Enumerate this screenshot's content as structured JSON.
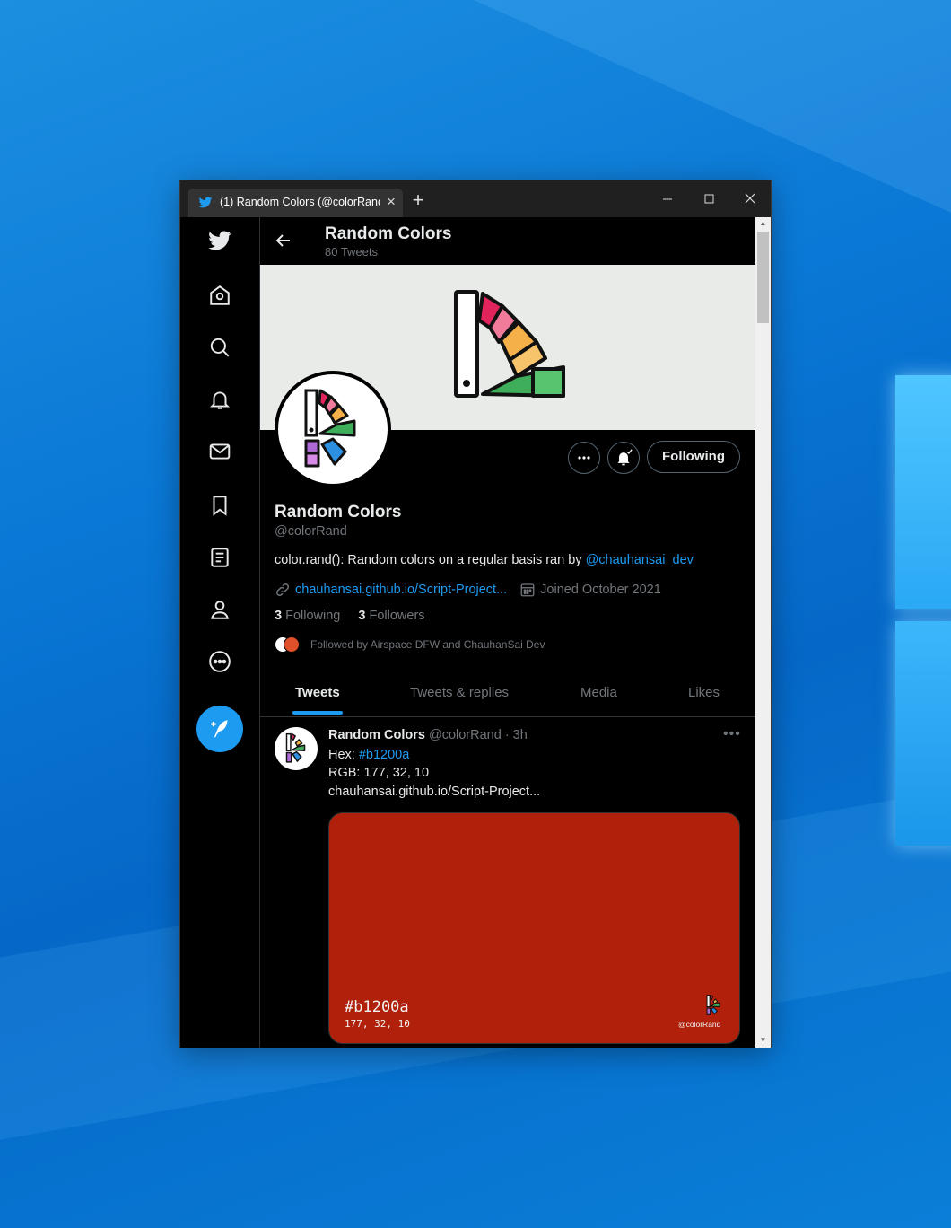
{
  "browser": {
    "tab_title": "(1) Random Colors (@colorRand",
    "close_tab": "×",
    "new_tab": "+"
  },
  "sidebar": {
    "items": [
      {
        "icon": "twitter-logo-icon"
      },
      {
        "icon": "home-icon"
      },
      {
        "icon": "search-icon"
      },
      {
        "icon": "bell-icon"
      },
      {
        "icon": "mail-icon"
      },
      {
        "icon": "bookmark-icon"
      },
      {
        "icon": "list-icon"
      },
      {
        "icon": "profile-icon"
      },
      {
        "icon": "more-icon"
      }
    ],
    "compose_icon": "compose-icon"
  },
  "header": {
    "title": "Random Colors",
    "tweet_count": "80 Tweets"
  },
  "profile": {
    "display_name": "Random Colors",
    "handle": "@colorRand",
    "bio_text": "color.rand(): Random colors on a regular basis ran by ",
    "bio_mention": "@chauhansai_dev",
    "website": "chauhansai.github.io/Script-Project...",
    "joined": "Joined October 2021",
    "following_count": "3",
    "following_label": "Following",
    "followers_count": "3",
    "followers_label": "Followers",
    "followed_by": "Followed by Airspace DFW and ChauhanSai Dev",
    "following_button": "Following"
  },
  "tabs": [
    {
      "label": "Tweets",
      "active": true
    },
    {
      "label": "Tweets & replies",
      "active": false
    },
    {
      "label": "Media",
      "active": false
    },
    {
      "label": "Likes",
      "active": false
    }
  ],
  "tweet": {
    "name": "Random Colors",
    "handle_time": "@colorRand · 3h",
    "hex_label": "Hex: ",
    "hex_tag": "#b1200a",
    "rgb_line": "RGB: 177, 32, 10",
    "link": "chauhansai.github.io/Script-Project...",
    "media": {
      "color": "#b1200a",
      "hex_text": "#b1200a",
      "rgb_text": "177, 32, 10",
      "handle": "@colorRand"
    }
  },
  "colors": {
    "accent": "#1d9bf0",
    "tweet_color": "#b1200a"
  }
}
